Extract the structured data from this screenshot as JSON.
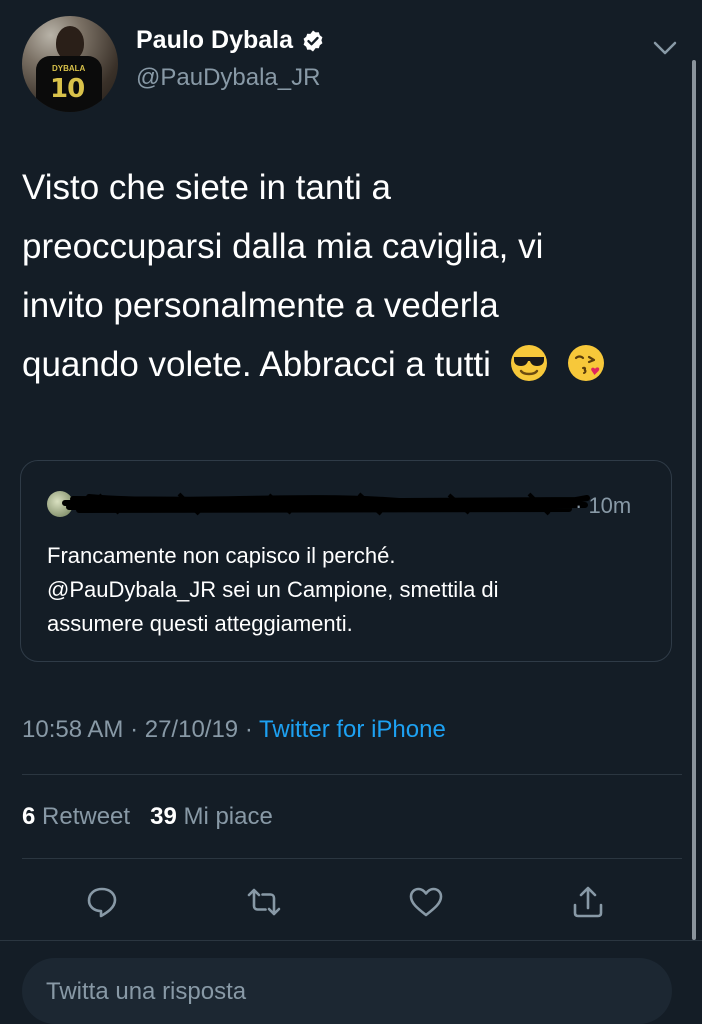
{
  "tweet": {
    "author_name": "Paulo Dybala",
    "author_handle": "@PauDybala_JR",
    "avatar_jersey_name": "DYBALA",
    "avatar_jersey_number": "10",
    "text_lines": [
      "Visto che siete in tanti a",
      "preoccuparsi dalla mia caviglia, vi",
      "invito personalmente a vederla",
      "quando volete. Abbracci a tutti"
    ],
    "emojis": [
      "smiling-face-with-sunglasses-icon",
      "face-blowing-a-kiss-icon"
    ],
    "timestamp": "10:58 AM · 27/10/19 · ",
    "source": "Twitter for iPhone"
  },
  "quote": {
    "time": "· 10m",
    "text_lines": [
      "Francamente non capisco il perché.",
      "@PauDybala_JR sei un Campione, smettila di",
      "assumere questi atteggiamenti."
    ]
  },
  "stats": {
    "retweets_count": "6",
    "retweets_label": "Retweet",
    "likes_count": "39",
    "likes_label": "Mi piace"
  },
  "actions": [
    "reply-icon",
    "retweet-icon",
    "like-icon",
    "share-icon"
  ],
  "reply": {
    "placeholder": "Twitta una risposta"
  },
  "colors": {
    "background": "#141d26",
    "secondary_text": "#8899a6",
    "link": "#1da1f2"
  }
}
